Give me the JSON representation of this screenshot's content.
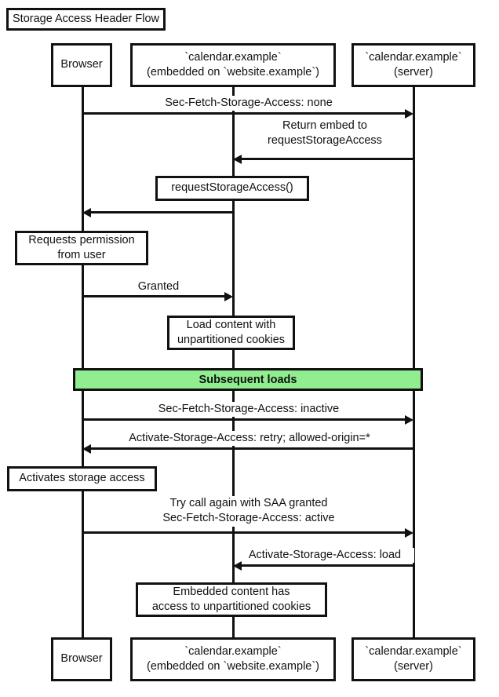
{
  "title": "Storage Access Header Flow",
  "participants": [
    {
      "id": "browser",
      "label": "Browser"
    },
    {
      "id": "embed",
      "label": "`calendar.example`\n(embedded on `website.example`)"
    },
    {
      "id": "server",
      "label": "`calendar.example`\n(server)"
    }
  ],
  "messages": [
    {
      "id": "m1",
      "label": "Sec-Fetch-Storage-Access: none",
      "from": "browser",
      "to": "server",
      "direction": "right"
    },
    {
      "id": "m2",
      "label": "Return embed to\nrequestStorageAccess",
      "from": "server",
      "to": "embed",
      "direction": "left"
    },
    {
      "id": "m3",
      "label": "",
      "from": "embed",
      "to": "browser",
      "direction": "left"
    },
    {
      "id": "m4",
      "label": "Granted",
      "from": "browser",
      "to": "embed",
      "direction": "right"
    },
    {
      "id": "m5",
      "label": "Sec-Fetch-Storage-Access: inactive",
      "from": "browser",
      "to": "server",
      "direction": "right"
    },
    {
      "id": "m6",
      "label": "Activate-Storage-Access: retry; allowed-origin=*",
      "from": "server",
      "to": "browser",
      "direction": "left"
    },
    {
      "id": "m7",
      "label": "Try call again with SAA granted\nSec-Fetch-Storage-Access: active",
      "from": "browser",
      "to": "server",
      "direction": "right"
    },
    {
      "id": "m8",
      "label": "Activate-Storage-Access: load",
      "from": "server",
      "to": "embed",
      "direction": "left"
    }
  ],
  "notes": [
    {
      "id": "n1",
      "label": "requestStorageAccess()",
      "over": "embed"
    },
    {
      "id": "n2",
      "label": "Requests permission\nfrom user",
      "over": "browser"
    },
    {
      "id": "n3",
      "label": "Load content with\nunpartitioned cookies",
      "over": "embed"
    },
    {
      "id": "n4",
      "label": "Activates storage access",
      "over": "browser"
    },
    {
      "id": "n5",
      "label": "Embedded content has\naccess to unpartitioned cookies",
      "over": "embed"
    }
  ],
  "divider": {
    "label": "Subsequent loads",
    "color": "#90ee90"
  },
  "colors": {
    "background": "#ffffff",
    "stroke": "#111111",
    "text": "#111111",
    "note_fill": "#ffffff",
    "divider_fill": "#90ee90"
  }
}
